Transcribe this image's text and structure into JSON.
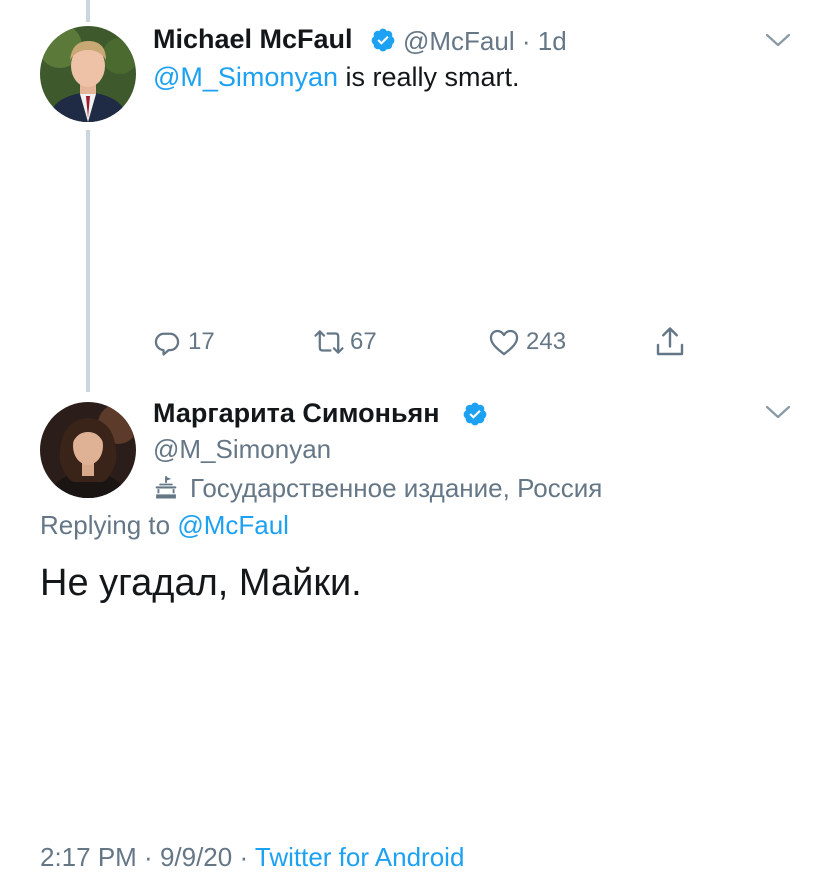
{
  "tweet1": {
    "author_name": "Michael McFaul",
    "handle": "@McFaul",
    "separator": "·",
    "time_ago": "1d",
    "mention": "@M_Simonyan",
    "text": " is really smart.",
    "reply_count": "17",
    "retweet_count": "67",
    "like_count": "243"
  },
  "tweet2": {
    "author_name": "Маргарита Симоньян",
    "handle": "@M_Simonyan",
    "affiliation_label": "Государственное издание, Россия",
    "replying_prefix": "Replying to ",
    "replying_handle": "@McFaul",
    "text": "Не угадал, Майки.",
    "time": "2:17 PM",
    "separator": " · ",
    "date": "9/9/20",
    "source": "Twitter for Android"
  },
  "colors": {
    "accent": "#1da1f2",
    "secondary_text": "#657786",
    "thread_line": "#ccd6dd"
  },
  "icons": {
    "verified": "verified-badge-icon",
    "chevron": "chevron-down-icon",
    "reply": "reply-icon",
    "retweet": "retweet-icon",
    "like": "heart-icon",
    "share": "share-icon",
    "state_media": "state-media-icon"
  }
}
